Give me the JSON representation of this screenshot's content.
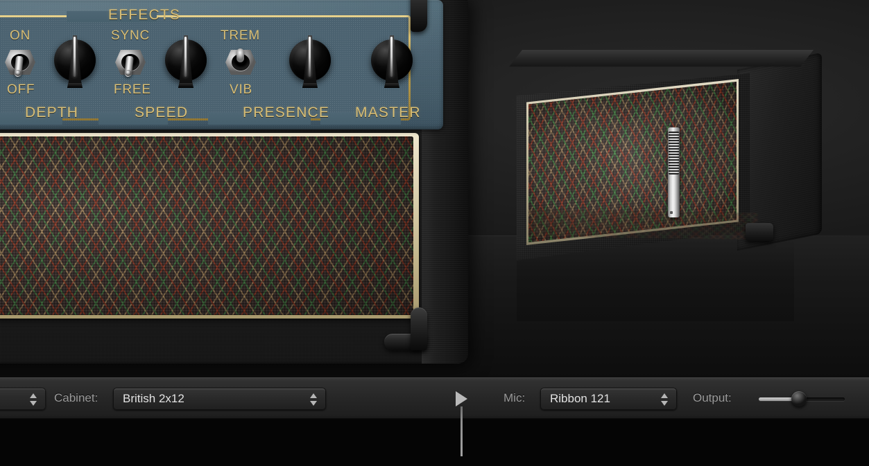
{
  "amp_panel": {
    "section_title": "EFFECTS",
    "switches": [
      {
        "name": "power",
        "top_label": "ON",
        "bottom_label": "OFF",
        "position": "down"
      },
      {
        "name": "sync",
        "top_label": "SYNC",
        "bottom_label": "FREE",
        "position": "down"
      },
      {
        "name": "mode",
        "top_label": "TREM",
        "bottom_label": "VIB",
        "position": "up"
      }
    ],
    "knobs": [
      {
        "name": "depth",
        "label": "DEPTH",
        "angle": 0
      },
      {
        "name": "speed",
        "label": "SPEED",
        "angle": 0
      },
      {
        "name": "presence",
        "label": "PRESENCE",
        "angle": 0
      },
      {
        "name": "master",
        "label": "MASTER",
        "angle": 0
      }
    ]
  },
  "cabinet_view": {
    "cabinet_name": "British 2x12",
    "mic_name": "Ribbon 121"
  },
  "toolbar": {
    "amp_stepper_label": "",
    "cabinet_label": "Cabinet:",
    "cabinet_value": "British 2x12",
    "mic_label": "Mic:",
    "mic_value": "Ribbon 121",
    "output_label": "Output:",
    "output_percent": 47,
    "disclosure_icon": "play-triangle-icon"
  },
  "colors": {
    "panel_teal": "#4b6270",
    "gold_trim": "#c8a84f",
    "gold_text": "#d8bd74",
    "toolbar_bg": "#272727",
    "text_light": "#e2e2e2",
    "text_dim": "#9a9a9a",
    "grille_green": "#3a7c3a",
    "grille_red": "#98321c",
    "grille_tan": "#aa8858"
  }
}
